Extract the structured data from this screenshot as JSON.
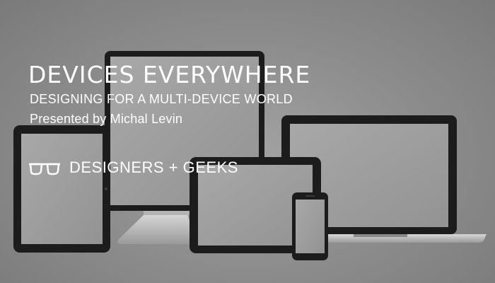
{
  "slide": {
    "title": "DEVICES EVERYWHERE",
    "subtitle": "DESIGNING FOR A MULTI-DEVICE WORLD",
    "presenter": "Presented by Michal Levin",
    "brand": {
      "name": "DESIGNERS + GEEKS",
      "icon": "glasses-icon"
    }
  },
  "colors": {
    "background": "#8f8f8f",
    "device_frame": "#1c1c1c",
    "screen": "#9d9d9d",
    "text": "#ffffff"
  }
}
